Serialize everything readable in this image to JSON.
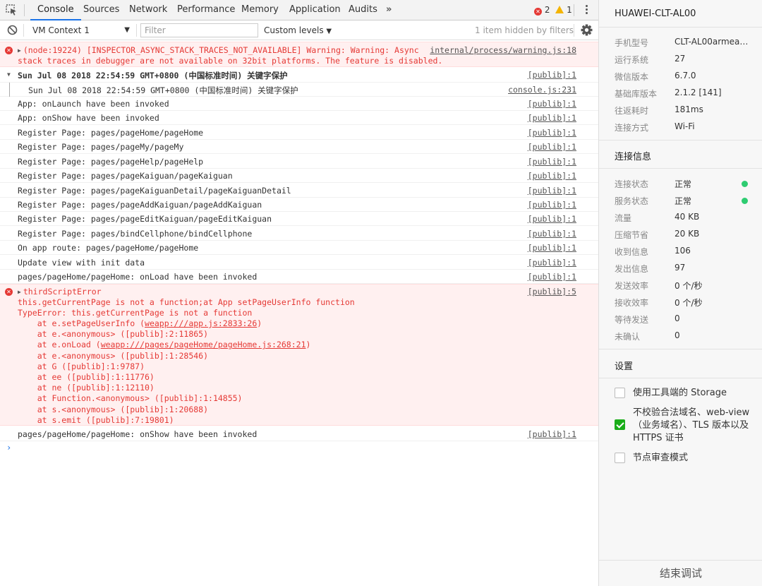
{
  "tabs": [
    {
      "label": "Console"
    },
    {
      "label": "Sources"
    },
    {
      "label": "Network"
    },
    {
      "label": "Performance"
    },
    {
      "label": "Memory"
    },
    {
      "label": "Application"
    },
    {
      "label": "Audits"
    }
  ],
  "more_tabs": "»",
  "status": {
    "errors": "2",
    "warnings": "1"
  },
  "toolbar": {
    "context": "VM Context 1",
    "filter_placeholder": "Filter",
    "levels": "Custom levels",
    "hidden_note": "1 item hidden by filters"
  },
  "console": {
    "warning": {
      "line1": "(node:19224) [INSPECTOR_ASYNC_STACK_TRACES_NOT_AVAILABLE] Warning: Warning: Async",
      "line2": "stack traces in debugger are not available on 32bit platforms. The feature is disabled.",
      "source": "internal/process/warning.js:18"
    },
    "group": {
      "header": "Sun Jul 08 2018 22:54:59 GMT+0800 (中国标准时间) 关键字保护",
      "header_source": "[publib]:1",
      "child": "Sun Jul 08 2018 22:54:59 GMT+0800 (中国标准时间) 关键字保护",
      "child_source": "console.js:231"
    },
    "logs": [
      {
        "text": "App: onLaunch have been invoked",
        "source": "[publib]:1"
      },
      {
        "text": "App: onShow have been invoked",
        "source": "[publib]:1"
      },
      {
        "text": "Register Page: pages/pageHome/pageHome",
        "source": "[publib]:1"
      },
      {
        "text": "Register Page: pages/pageMy/pageMy",
        "source": "[publib]:1"
      },
      {
        "text": "Register Page: pages/pageHelp/pageHelp",
        "source": "[publib]:1"
      },
      {
        "text": "Register Page: pages/pageKaiguan/pageKaiguan",
        "source": "[publib]:1"
      },
      {
        "text": "Register Page: pages/pageKaiguanDetail/pageKaiguanDetail",
        "source": "[publib]:1"
      },
      {
        "text": "Register Page: pages/pageAddKaiguan/pageAddKaiguan",
        "source": "[publib]:1"
      },
      {
        "text": "Register Page: pages/pageEditKaiguan/pageEditKaiguan",
        "source": "[publib]:1"
      },
      {
        "text": "Register Page: pages/bindCellphone/bindCellphone",
        "source": "[publib]:1"
      },
      {
        "text": "On app route: pages/pageHome/pageHome",
        "source": "[publib]:1"
      },
      {
        "text": "Update view with init data",
        "source": "[publib]:1"
      },
      {
        "text": "pages/pageHome/pageHome: onLoad have been invoked",
        "source": "[publib]:1"
      }
    ],
    "error": {
      "title": "thirdScriptError",
      "source": "[publib]:5",
      "line1": "this.getCurrentPage is not a function;at App setPageUserInfo function",
      "line2": "TypeError: this.getCurrentPage is not a function",
      "stack": [
        {
          "pre": "    at e.setPageUserInfo (",
          "link": "weapp:///app.js:2833:26",
          "post": ")"
        },
        {
          "pre": "    at e.<anonymous> ([publib]:2:11865)",
          "link": "",
          "post": ""
        },
        {
          "pre": "    at e.onLoad (",
          "link": "weapp:///pages/pageHome/pageHome.js:268:21",
          "post": ")"
        },
        {
          "pre": "    at e.<anonymous> ([publib]:1:28546)",
          "link": "",
          "post": ""
        },
        {
          "pre": "    at G ([publib]:1:9787)",
          "link": "",
          "post": ""
        },
        {
          "pre": "    at ee ([publib]:1:11776)",
          "link": "",
          "post": ""
        },
        {
          "pre": "    at ne ([publib]:1:12110)",
          "link": "",
          "post": ""
        },
        {
          "pre": "    at Function.<anonymous> ([publib]:1:14855)",
          "link": "",
          "post": ""
        },
        {
          "pre": "    at s.<anonymous> ([publib]:1:20688)",
          "link": "",
          "post": ""
        },
        {
          "pre": "    at s.emit ([publib]:7:19801)",
          "link": "",
          "post": ""
        }
      ]
    },
    "last": {
      "text": "pages/pageHome/pageHome: onShow have been invoked",
      "source": "[publib]:1"
    },
    "prompt": "›"
  },
  "panel": {
    "device": "HUAWEI-CLT-AL00",
    "info": [
      {
        "k": "手机型号",
        "v": "CLT-AL00armeab…"
      },
      {
        "k": "运行系统",
        "v": "27"
      },
      {
        "k": "微信版本",
        "v": "6.7.0"
      },
      {
        "k": "基础库版本",
        "v": "2.1.2 [141]"
      },
      {
        "k": "往返耗时",
        "v": "181ms"
      },
      {
        "k": "连接方式",
        "v": "Wi-Fi"
      }
    ],
    "conn_title": "连接信息",
    "conn": [
      {
        "k": "连接状态",
        "v": "正常",
        "dot": true
      },
      {
        "k": "服务状态",
        "v": "正常",
        "dot": true
      },
      {
        "k": "流量",
        "v": "40 KB"
      },
      {
        "k": "压缩节省",
        "v": "20 KB"
      },
      {
        "k": "收到信息",
        "v": "106"
      },
      {
        "k": "发出信息",
        "v": "97"
      },
      {
        "k": "发送效率",
        "v": "0 个/秒"
      },
      {
        "k": "接收效率",
        "v": "0 个/秒"
      },
      {
        "k": "等待发送",
        "v": "0"
      },
      {
        "k": "未确认",
        "v": "0"
      }
    ],
    "settings_title": "设置",
    "settings": [
      {
        "label": "使用工具端的 Storage",
        "checked": false
      },
      {
        "label": "不校验合法域名、web-view（业务域名）、TLS 版本以及 HTTPS 证书",
        "checked": true
      },
      {
        "label": "节点审查模式",
        "checked": false
      }
    ],
    "end_button": "结束调试",
    "accent_green": "#1aad19"
  }
}
